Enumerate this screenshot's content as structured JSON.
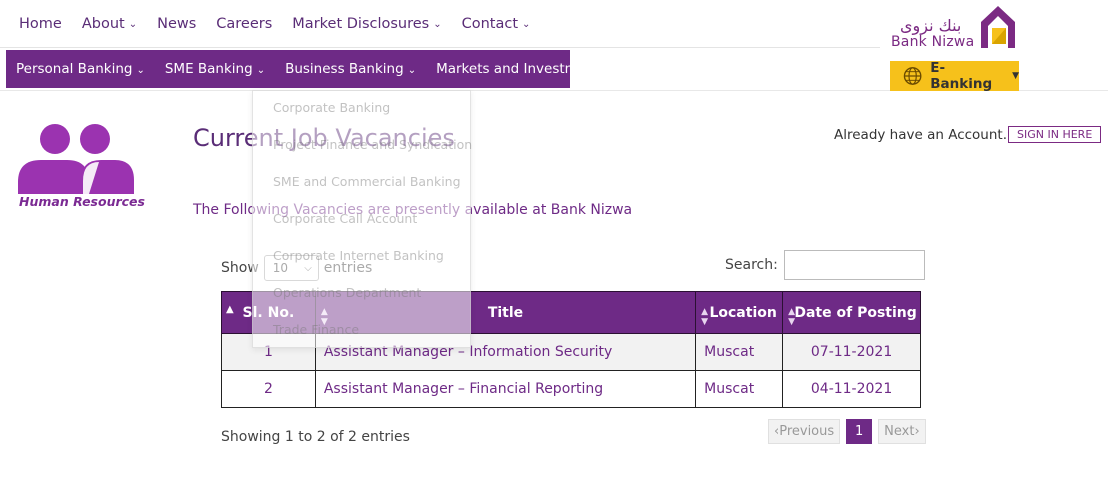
{
  "topnav": [
    {
      "label": "Home",
      "dropdown": false
    },
    {
      "label": "About",
      "dropdown": true
    },
    {
      "label": "News",
      "dropdown": false
    },
    {
      "label": "Careers",
      "dropdown": false
    },
    {
      "label": "Market Disclosures",
      "dropdown": true
    },
    {
      "label": "Contact",
      "dropdown": true
    }
  ],
  "logo": {
    "arabic": "بنك نزوى",
    "latin": "Bank Nizwa"
  },
  "mainmenu": [
    {
      "label": "Personal Banking"
    },
    {
      "label": "SME Banking"
    },
    {
      "label": "Business Banking"
    },
    {
      "label": "Markets and Investments"
    }
  ],
  "ebanking": {
    "label": "E-Banking",
    "icon": "globe-icon"
  },
  "hr": {
    "caption": "Human Resources",
    "icon": "people-icon"
  },
  "page": {
    "title": "Current Job Vacancies",
    "subtitle": "The Following Vacancies are presently available at Bank Nizwa"
  },
  "account": {
    "prompt": "Already have an Account.",
    "signin": "SIGN IN HERE"
  },
  "controls": {
    "show": "Show",
    "entries_value": "10",
    "entries": "entries",
    "search_label": "Search:",
    "search_value": ""
  },
  "table": {
    "headers": {
      "no": "Sl. No.",
      "title": "Title",
      "location": "Location",
      "date": "Date of Posting"
    },
    "rows": [
      {
        "no": "1",
        "title": "Assistant Manager – Information Security",
        "location": "Muscat",
        "date": "07-11-2021"
      },
      {
        "no": "2",
        "title": "Assistant Manager – Financial Reporting",
        "location": "Muscat",
        "date": "04-11-2021"
      }
    ]
  },
  "footer": {
    "info": "Showing 1 to 2 of 2 entries",
    "previous": "Previous",
    "current_page": "1",
    "next": "Next"
  },
  "dropdown": [
    "Corporate Banking",
    "Project Finance and Syndication",
    "SME and Commercial Banking",
    "Corporate Call Account",
    "Corporate Internet Banking",
    "Operations Department",
    "Trade Finance"
  ],
  "colors": {
    "purple": "#6e2a86",
    "yellow": "#f6c11b"
  }
}
